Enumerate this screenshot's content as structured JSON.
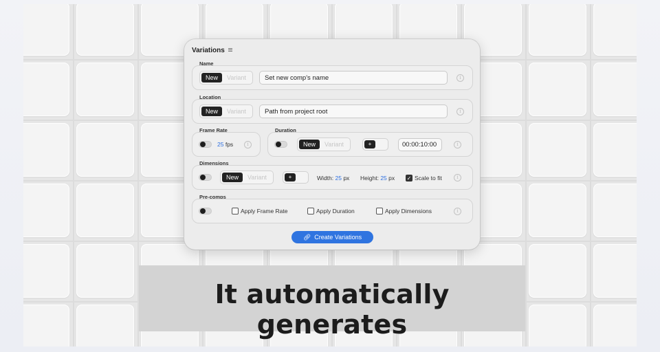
{
  "caption": "It automatically generates",
  "panel": {
    "title": "Variations",
    "name": {
      "label": "Name",
      "seg_on": "New",
      "seg_off": "Variant",
      "value": "Set new comp's name"
    },
    "location": {
      "label": "Location",
      "seg_on": "New",
      "seg_off": "Variant",
      "value": "Path from project root"
    },
    "frame_rate": {
      "label": "Frame Rate",
      "value": "25",
      "unit": "fps"
    },
    "duration": {
      "label": "Duration",
      "seg_on": "New",
      "seg_off": "Variant",
      "plus": "+",
      "value": "00:00:10:00"
    },
    "dimensions": {
      "label": "Dimensions",
      "seg_on": "New",
      "seg_off": "Variant",
      "plus": "+",
      "width_label": "Width:",
      "width_value": "25",
      "width_unit": "px",
      "height_label": "Height:",
      "height_value": "25",
      "height_unit": "px",
      "scale_label": "Scale to fit"
    },
    "precomps": {
      "label": "Pre-comps",
      "apply_frame_rate": "Apply Frame Rate",
      "apply_duration": "Apply Duration",
      "apply_dimensions": "Apply Dimensions"
    },
    "create_button": "Create Variations"
  },
  "colors": {
    "accent": "#2f74e0",
    "highlight_text": "#2d6fe0"
  },
  "icons": [
    "menu-icon",
    "info-icon",
    "link-icon",
    "check-icon"
  ]
}
